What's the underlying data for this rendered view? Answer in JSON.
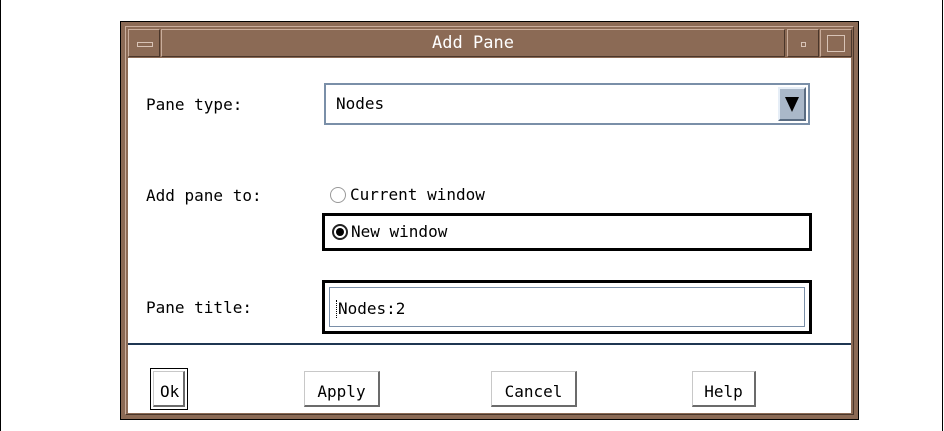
{
  "window": {
    "title": "Add Pane"
  },
  "form": {
    "pane_type": {
      "label": "Pane type:",
      "selected": "Nodes"
    },
    "add_pane_to": {
      "label": "Add pane to:",
      "options": [
        {
          "label": "Current window",
          "selected": false
        },
        {
          "label": "New window",
          "selected": true
        }
      ]
    },
    "pane_title": {
      "label": "Pane title:",
      "value": "Nodes:2"
    }
  },
  "buttons": {
    "ok": "Ok",
    "apply": "Apply",
    "cancel": "Cancel",
    "help": "Help"
  },
  "icons": {
    "window_menu": "window-menu-icon",
    "minimize": "minimize-icon",
    "maximize": "maximize-icon",
    "dropdown": "triangle-down-icon"
  },
  "colors": {
    "frame": "#8b6a55",
    "title_text": "#ffffff",
    "divider": "#1f3652",
    "combo_arrow": "#aab8c9"
  }
}
